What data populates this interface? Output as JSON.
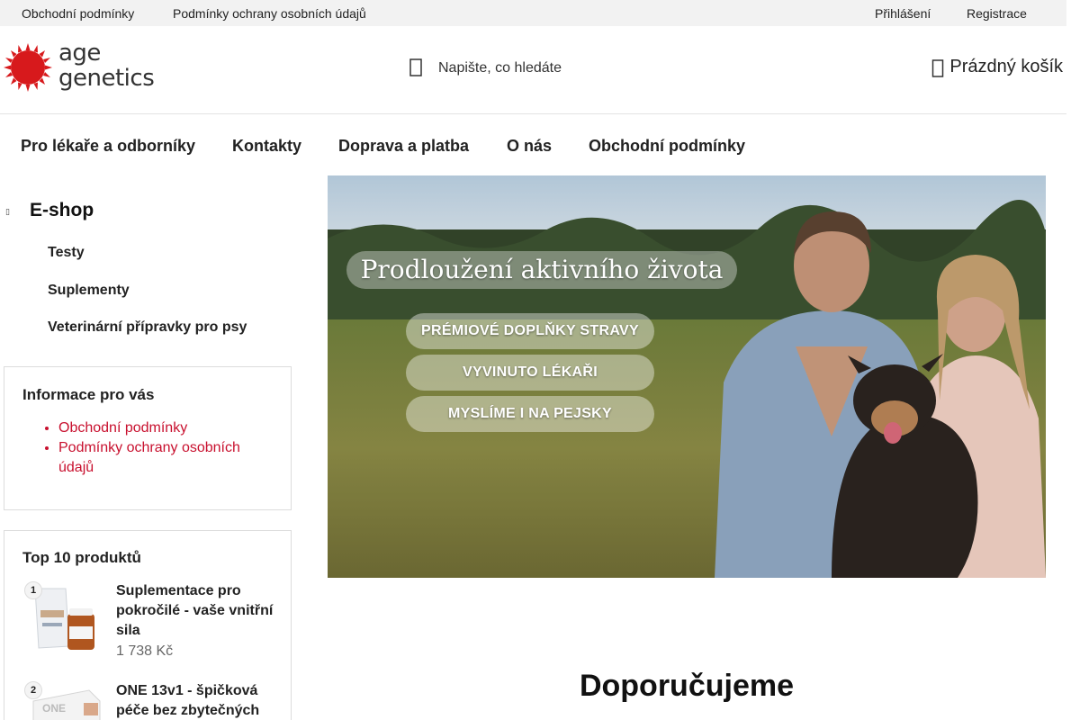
{
  "topbar": {
    "links": [
      "Obchodní podmínky",
      "Podmínky ochrany osobních údajů"
    ],
    "login": "Přihlášení",
    "register": "Registrace"
  },
  "header": {
    "logo_line1": "age",
    "logo_line2": "genetics",
    "search_placeholder": "Napište, co hledáte",
    "search_icon": "search-icon",
    "cart_label": "Prázdný košík",
    "cart_icon": "cart-icon",
    "brand_color": "#d7191c"
  },
  "nav": {
    "items": [
      "Pro lékaře a odborníky",
      "Kontakty",
      "Doprava a platba",
      "O nás",
      "Obchodní podmínky"
    ]
  },
  "sidebar": {
    "eshop_title": "E-shop",
    "categories": [
      "Testy",
      "Suplementy",
      "Veterinární přípravky pro psy"
    ],
    "info_box": {
      "title": "Informace pro vás",
      "links": [
        "Obchodní podmínky",
        "Podmínky ochrany osobních údajů"
      ]
    },
    "top_products": {
      "title": "Top 10 produktů",
      "items": [
        {
          "rank": "1",
          "name": "Suplementace pro pokročilé - vaše vnitřní sila",
          "price": "1 738 Kč"
        },
        {
          "rank": "2",
          "name": "ONE 13v1 - špičková péče bez zbytečných",
          "price": ""
        }
      ]
    }
  },
  "banner": {
    "headline": "Prodloužení aktivního života",
    "pills": [
      "PRÉMIOVÉ DOPLŇKY STRAVY",
      "VYVINUTO LÉKAŘI",
      "MYSLÍME I NA PEJSKY"
    ]
  },
  "main": {
    "section_title": "Doporučujeme"
  },
  "colors": {
    "link_red": "#c8102e",
    "topbar_bg": "#f2f2f2"
  }
}
